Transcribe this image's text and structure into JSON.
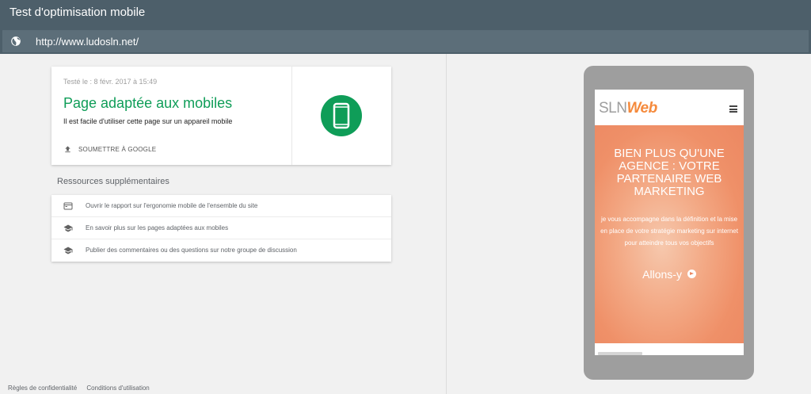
{
  "app": {
    "title": "Test d'optimisation mobile"
  },
  "urlbar": {
    "url": "http://www.ludosln.net/",
    "icon": "globe-icon"
  },
  "result": {
    "tested_label": "Testé le : 8 févr. 2017 à 15:49",
    "headline": "Page adaptée aux mobiles",
    "description": "Il est facile d'utiliser cette page sur un appareil mobile",
    "submit_label": "SOUMETTRE À GOOGLE",
    "badge_icon": "smartphone-icon",
    "accent_color": "#0f9d58"
  },
  "resources": {
    "title": "Ressources supplémentaires",
    "items": [
      {
        "label": "Ouvrir le rapport sur l'ergonomie mobile de l'ensemble du site",
        "icon": "report-icon"
      },
      {
        "label": "En savoir plus sur les pages adaptées aux mobiles",
        "icon": "school-icon"
      },
      {
        "label": "Publier des commentaires ou des questions sur notre groupe de discussion",
        "icon": "school-icon"
      }
    ]
  },
  "footer": {
    "privacy": "Règles de confidentialité",
    "terms": "Conditions d'utilisation"
  },
  "preview": {
    "logo_part1": "SLN",
    "logo_part2": "Web",
    "hero_title": "BIEN PLUS QU'UNE AGENCE : VOTRE PARTENAIRE WEB MARKETING",
    "hero_text": "je vous accompagne dans la définition et la mise en place de votre stratégie marketing sur internet pour atteindre tous vos objectifs",
    "cta_label": "Allons-y"
  }
}
